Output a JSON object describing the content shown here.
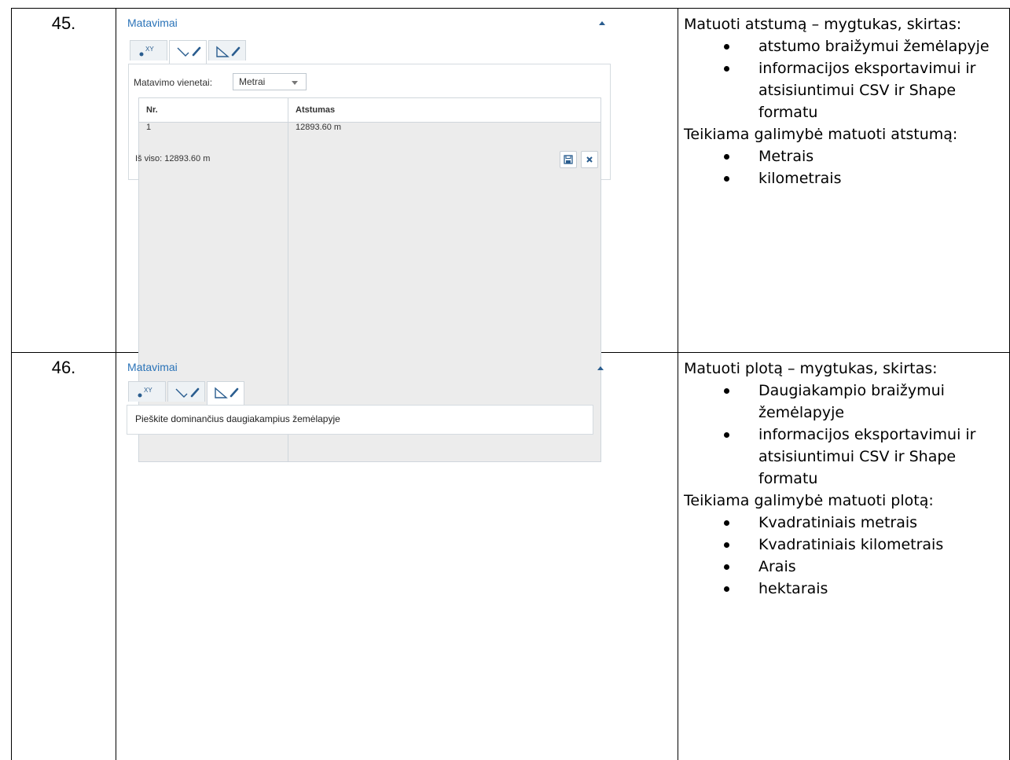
{
  "rows": [
    {
      "number": "45.",
      "panel": {
        "title": "Matavimai",
        "units_label": "Matavimo vienetai:",
        "units_value": "Metrai",
        "table": {
          "headers": [
            "Nr.",
            "Atstumas"
          ],
          "rows": [
            [
              "1",
              "12893.60 m"
            ]
          ]
        },
        "total": "Iš viso: 12893.60 m",
        "icons": [
          "point-xy-icon",
          "line-measure-icon",
          "area-measure-icon",
          "save-icon",
          "close-icon"
        ]
      },
      "desc": {
        "intro": "Matuoti atstumą – mygtukas, skirtas:",
        "purposes": [
          "atstumo braižymui žemėlapyje",
          "informacijos eksportavimui ir atsisiuntimui CSV ir Shape formatu"
        ],
        "options_intro": "Teikiama galimybė matuoti atstumą:",
        "options": [
          "Metrais",
          "kilometrais"
        ]
      }
    },
    {
      "number": "46.",
      "panel": {
        "title": "Matavimai",
        "hint": "Pieškite dominančius daugiakampius žemėlapyje",
        "icons": [
          "point-xy-icon",
          "line-measure-icon",
          "area-measure-icon"
        ]
      },
      "desc": {
        "intro": "Matuoti plotą – mygtukas, skirtas:",
        "purposes": [
          "Daugiakampio braižymui žemėlapyje",
          "informacijos eksportavimui ir atsisiuntimui CSV ir Shape formatu"
        ],
        "options_intro": "Teikiama galimybė matuoti plotą:",
        "options": [
          "Kvadratiniais metrais",
          "Kvadratiniais kilometrais",
          "Arais",
          "hektarais"
        ]
      }
    }
  ],
  "colors": {
    "panel_title": "#2a73b8",
    "border": "#000000",
    "table_row_bg": "#ececec"
  }
}
